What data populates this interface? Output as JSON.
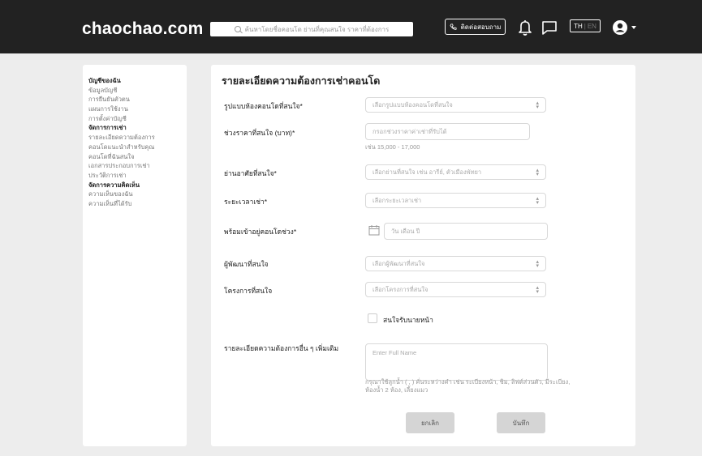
{
  "header": {
    "logo": "chaochao.com",
    "search_placeholder": "ค้นหาโดยชื่อคอนโด ย่านที่คุณสนใจ ราคาที่ต้องการ",
    "contact_label": "ติดต่อสอบถาม",
    "lang_th": "TH",
    "lang_sep": "|",
    "lang_en": "EN"
  },
  "sidebar": {
    "items": [
      {
        "label": "บัญชีของฉัน",
        "head": true
      },
      {
        "label": "ข้อมูลบัญชี",
        "head": false
      },
      {
        "label": "การยืนยันตัวตน",
        "head": false
      },
      {
        "label": "แผนการใช้งาน",
        "head": false
      },
      {
        "label": "การตั้งค่าบัญชี",
        "head": false
      },
      {
        "label": "จัดการการเช่า",
        "head": true
      },
      {
        "label": "รายละเอียดความต้องการ",
        "head": false
      },
      {
        "label": "คอนโดแนะนำสำหรับคุณ",
        "head": false
      },
      {
        "label": "คอนโดที่ฉันสนใจ",
        "head": false
      },
      {
        "label": "เอกสารประกอบการเช่า",
        "head": false
      },
      {
        "label": "ประวัติการเช่า",
        "head": false
      },
      {
        "label": "จัดการความคิดเห็น",
        "head": true
      },
      {
        "label": "ความเห็นของฉัน",
        "head": false
      },
      {
        "label": "ความเห็นที่ได้รับ",
        "head": false
      }
    ]
  },
  "form": {
    "title": "รายละเอียดความต้องการเช่าคอนโด",
    "room_type": {
      "label": "รูปแบบห้องคอนโดที่สนใจ*",
      "placeholder": "เลือกรูปแบบห้องคอนโดที่สนใจ"
    },
    "price": {
      "label": "ช่วงราคาที่สนใจ (บาท)*",
      "placeholder": "กรอกช่วงราคาค่าเช่าที่รับได้",
      "hint": "เช่น 15,000 - 17,000"
    },
    "area": {
      "label": "ย่านอาศัยที่สนใจ*",
      "placeholder": "เลือกย่านที่สนใจ เช่น อารีย์, ตัวเมืองพัทยา"
    },
    "duration": {
      "label": "ระยะเวลาเช่า*",
      "placeholder": "เลือกระยะเวลาเช่า"
    },
    "move_in": {
      "label": "พร้อมเข้าอยู่คอนโดช่วง*",
      "placeholder": "วัน เดือน ปี"
    },
    "developer": {
      "label": "ผู้พัฒนาที่สนใจ",
      "placeholder": "เลือกผู้พัฒนาที่สนใจ"
    },
    "project": {
      "label": "โครงการที่สนใจ",
      "placeholder": "เลือกโครงการที่สนใจ"
    },
    "agent": {
      "label": "สนใจรับนายหน้า"
    },
    "details": {
      "label": "รายละเอียดความต้องการอื่น ๆ เพิ่มเติม",
      "placeholder": "Enter Full Name",
      "hint": "กรุณาใช้ลูกน้ำ ( , ) คั่นระหว่างคำ เช่น ระเบียงหน้า, ชิม, ลิฟต์ส่วนตัว, มีระเบียง, ห้องน้ำ 2 ห้อง, เลี้ยงแมว"
    },
    "cancel_label": "ยกเลิก",
    "save_label": "บันทึก"
  }
}
